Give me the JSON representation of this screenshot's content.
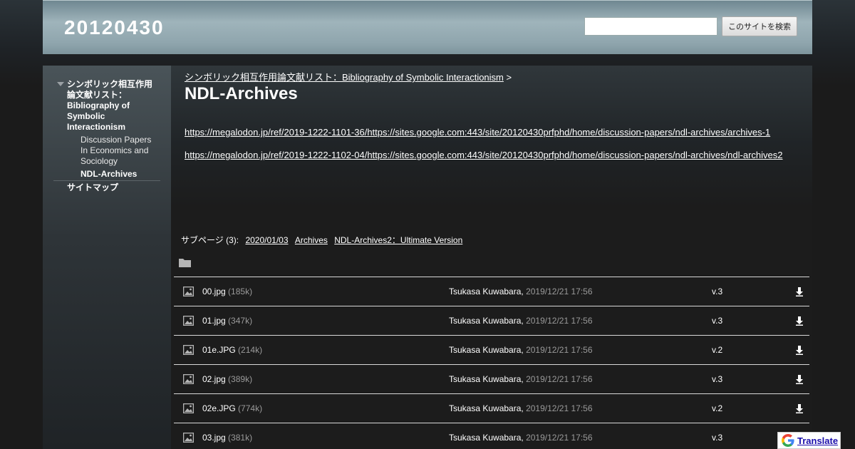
{
  "header": {
    "site_title": "20120430",
    "search_placeholder": "",
    "search_button": "このサイトを検索"
  },
  "sidebar": {
    "parent": "シンボリック相互作用論文献リスト：Bibliography of Symbolic Interactionism",
    "child1": "Discussion Papers In Economics and Sociology",
    "child2": "NDL-Archives",
    "sitemap": "サイトマップ"
  },
  "main": {
    "breadcrumb": "シンボリック相互作用論文献リスト：Bibliography of Symbolic Interactionism",
    "breadcrumb_sep": ">",
    "title": "NDL-Archives",
    "links": [
      "https://megalodon.jp/ref/2019-1222-1101-36/https://sites.google.com:443/site/20120430prfphd/home/discussion-papers/ndl-archives/archives-1",
      "https://megalodon.jp/ref/2019-1222-1102-04/https://sites.google.com:443/site/20120430prfphd/home/discussion-papers/ndl-archives/ndl-archives2"
    ],
    "subpages_label": "サブページ (3):",
    "subpages": [
      "2020/01/03",
      "Archives",
      "NDL-Archives2：Ultimate Version"
    ]
  },
  "files": [
    {
      "name": "00.jpg",
      "size": "(185k)",
      "author": "Tsukasa Kuwabara,",
      "date": "2019/12/21 17:56",
      "version": "v.3"
    },
    {
      "name": "01.jpg",
      "size": "(347k)",
      "author": "Tsukasa Kuwabara,",
      "date": "2019/12/21 17:56",
      "version": "v.3"
    },
    {
      "name": "01e.JPG",
      "size": "(214k)",
      "author": "Tsukasa Kuwabara,",
      "date": "2019/12/21 17:56",
      "version": "v.2"
    },
    {
      "name": "02.jpg",
      "size": "(389k)",
      "author": "Tsukasa Kuwabara,",
      "date": "2019/12/21 17:56",
      "version": "v.3"
    },
    {
      "name": "02e.JPG",
      "size": "(774k)",
      "author": "Tsukasa Kuwabara,",
      "date": "2019/12/21 17:56",
      "version": "v.2"
    },
    {
      "name": "03.jpg",
      "size": "(381k)",
      "author": "Tsukasa Kuwabara,",
      "date": "2019/12/21 17:56",
      "version": "v.3"
    }
  ],
  "icons": {
    "folder": "folder-icon",
    "image": "image-icon",
    "download": "download-icon",
    "google": "google-icon"
  },
  "translate": {
    "label": "Translate"
  }
}
